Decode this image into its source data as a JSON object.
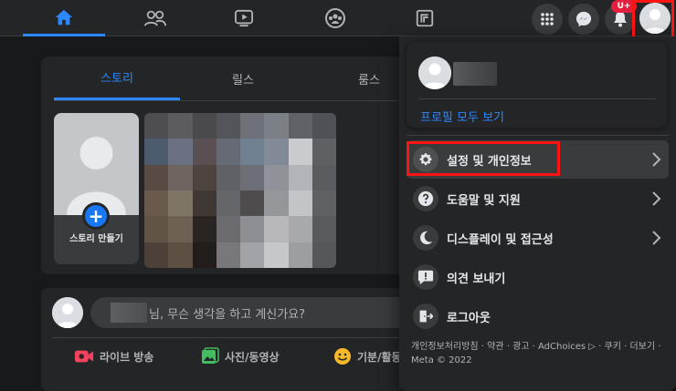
{
  "topbar": {
    "nav_tabs": [
      {
        "name": "home-icon",
        "active": true
      },
      {
        "name": "friends-icon",
        "active": false
      },
      {
        "name": "watch-icon",
        "active": false
      },
      {
        "name": "groups-icon",
        "active": false
      },
      {
        "name": "gaming-icon",
        "active": false
      }
    ],
    "notification_badge": "U+"
  },
  "stories": {
    "tabs": [
      {
        "label": "스토리",
        "active": true
      },
      {
        "label": "릴스",
        "active": false
      },
      {
        "label": "룸스",
        "active": false
      }
    ],
    "create_label": "스토리 만들기",
    "plus": "+"
  },
  "composer": {
    "placeholder": "님, 무슨 생각을 하고 계신가요?",
    "actions": [
      {
        "label": "라이브 방송",
        "icon": "live-video-icon",
        "color": "#f3425f"
      },
      {
        "label": "사진/동영상",
        "icon": "photo-video-icon",
        "color": "#45bd62"
      },
      {
        "label": "기분/활동",
        "icon": "feeling-icon",
        "color": "#f7b928"
      }
    ]
  },
  "account_menu": {
    "profile_link": "프로필 모두 보기",
    "items": [
      {
        "label": "설정 및 개인정보",
        "icon": "gear-icon",
        "has_arrow": true
      },
      {
        "label": "도움말 및 지원",
        "icon": "help-icon",
        "has_arrow": true
      },
      {
        "label": "디스플레이 및 접근성",
        "icon": "moon-icon",
        "has_arrow": true
      },
      {
        "label": "의견 보내기",
        "icon": "feedback-icon",
        "has_arrow": false
      },
      {
        "label": "로그아웃",
        "icon": "logout-icon",
        "has_arrow": false
      }
    ],
    "footer": "개인정보처리방침 · 약관 · 광고 · AdChoices ▷ · 쿠키 · 더보기 · Meta © 2022"
  },
  "colors": {
    "accent": "#2d88ff",
    "highlight_box": "#ff1414",
    "background": "#18191a",
    "surface": "#242526"
  }
}
